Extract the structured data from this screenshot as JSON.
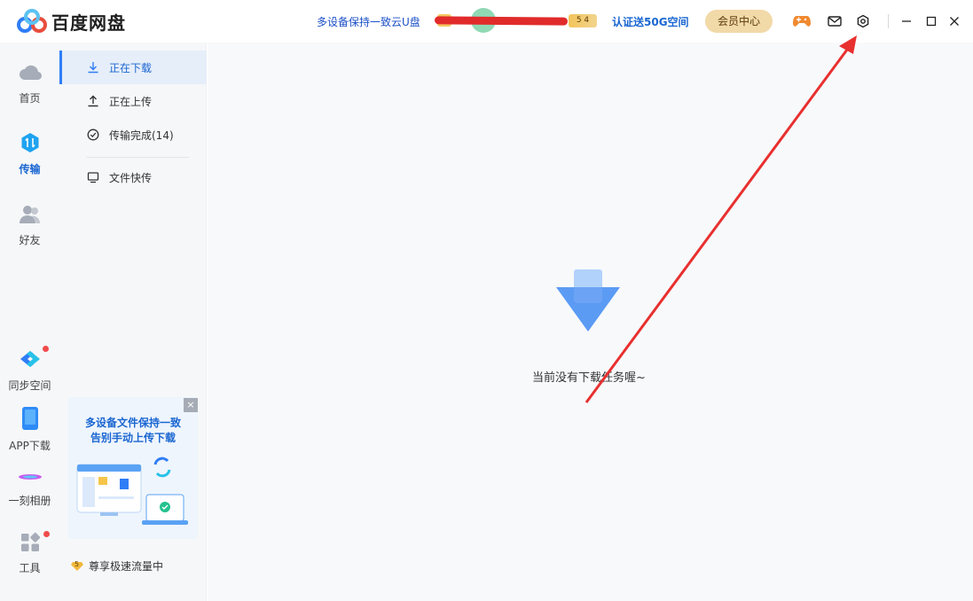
{
  "titlebar": {
    "app_title": "百度网盘",
    "promo": "多设备保持一致云U盘",
    "vip_level": "5 4",
    "verify": "认证送50G空间",
    "member_center": "会员中心"
  },
  "nav": {
    "home": "首页",
    "transfer": "传输",
    "friends": "好友",
    "sync": "同步空间",
    "app_download": "APP下载",
    "album": "一刻相册",
    "tools": "工具"
  },
  "subnav": {
    "downloading": "正在下载",
    "uploading": "正在上传",
    "completed": "传输完成(14)",
    "quick_transfer": "文件快传"
  },
  "ad": {
    "line1": "多设备文件保持一致",
    "line2": "告别手动上传下载",
    "close": "×"
  },
  "speed": {
    "badge": "5",
    "text": "尊享极速流量中"
  },
  "main": {
    "empty": "当前没有下载任务喔~"
  },
  "colors": {
    "accent": "#2f7df6",
    "annotation_arrow": "#e8302f"
  }
}
